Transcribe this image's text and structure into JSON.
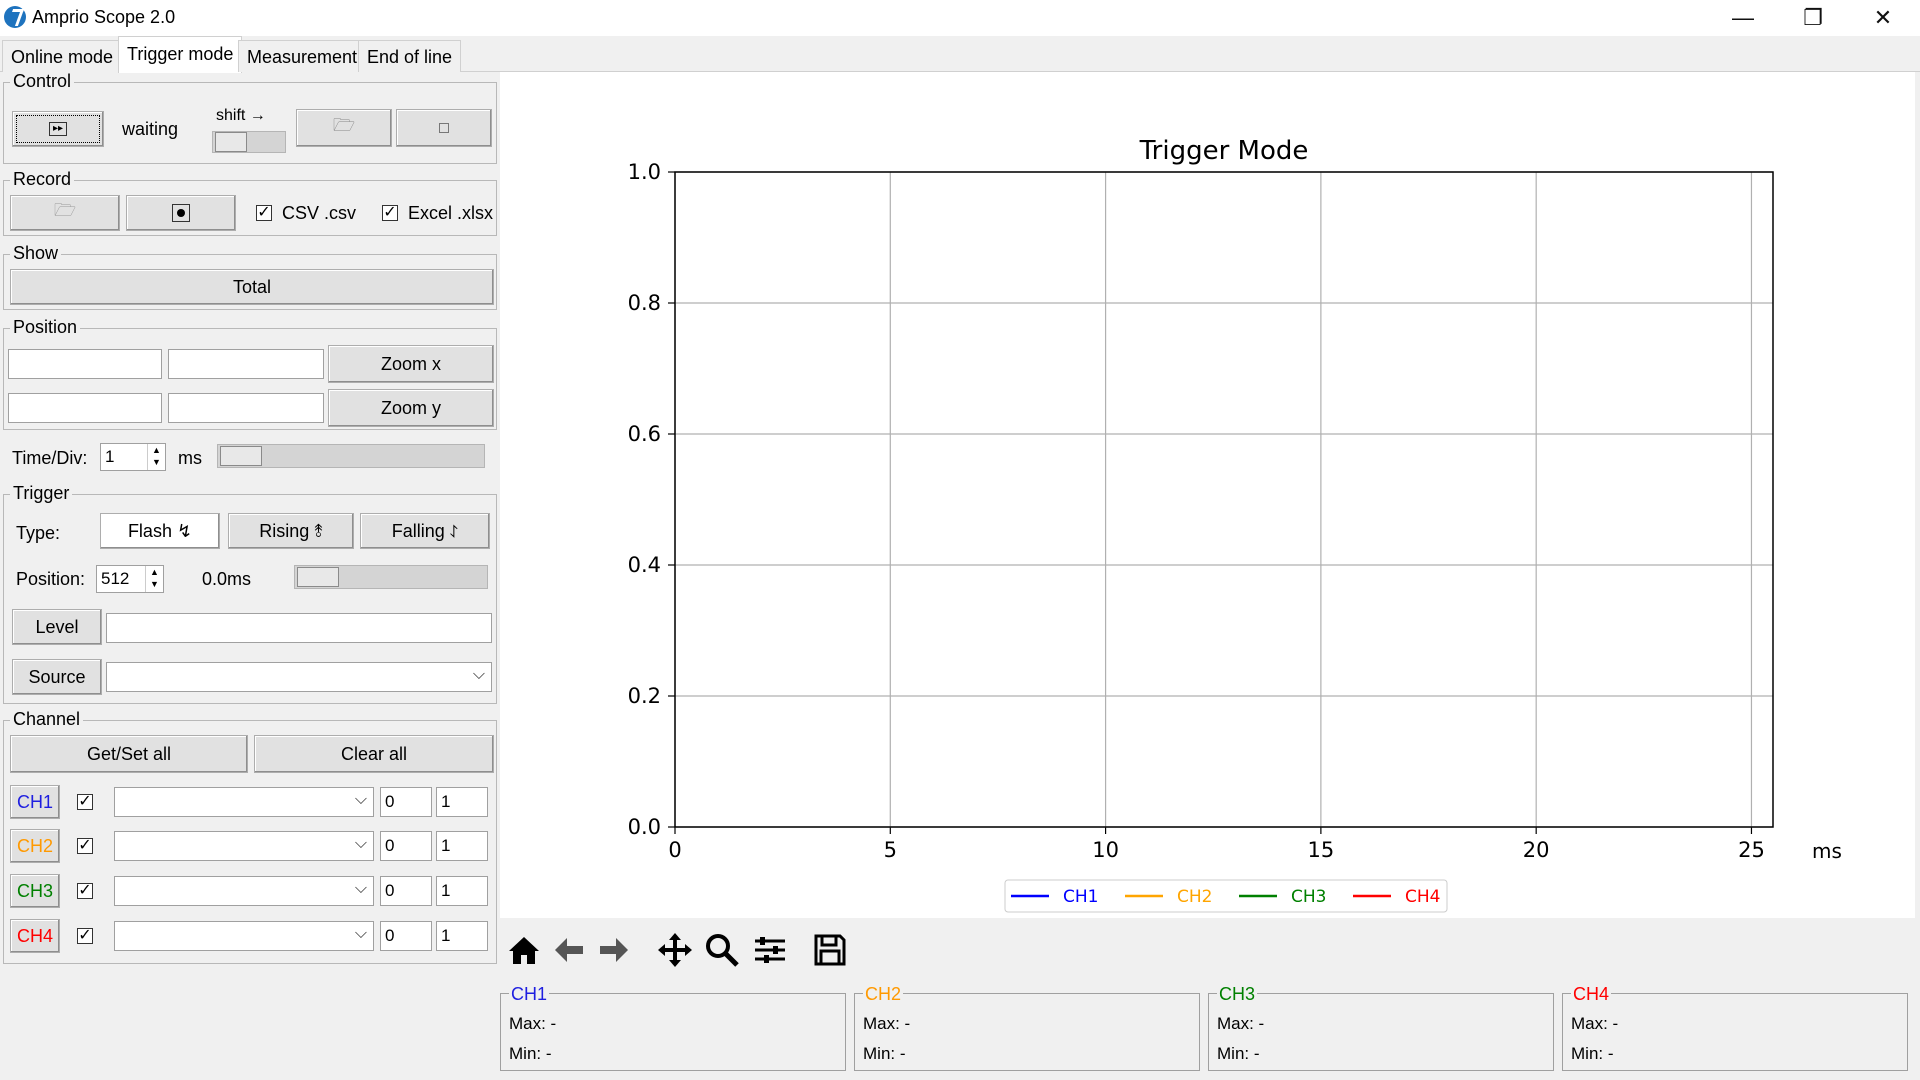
{
  "window": {
    "title": "Amprio Scope 2.0",
    "minimize": "—",
    "restore": "❐",
    "close": "✕"
  },
  "tabs": [
    "Online mode",
    "Trigger mode",
    "Measurement",
    "End of line"
  ],
  "control": {
    "title": "Control",
    "status": "waiting",
    "shift_label": "shift →"
  },
  "record": {
    "title": "Record",
    "csv_label": "CSV .csv",
    "excel_label": "Excel .xlsx",
    "csv_checked": true,
    "excel_checked": true
  },
  "show": {
    "title": "Show",
    "total_label": "Total"
  },
  "position": {
    "title": "Position",
    "zoom_x": "Zoom x",
    "zoom_y": "Zoom y"
  },
  "timediv": {
    "label": "Time/Div:",
    "value": "1",
    "unit": "ms"
  },
  "trigger": {
    "title": "Trigger",
    "type_label": "Type:",
    "flash": "Flash ↯",
    "rising": "Rising ⥉",
    "falling": "Falling ⥌",
    "position_label": "Position:",
    "position_value": "512",
    "time_value": "0.0ms",
    "level_label": "Level",
    "source_label": "Source"
  },
  "channel": {
    "title": "Channel",
    "get_set_all": "Get/Set all",
    "clear_all": "Clear all",
    "rows": [
      {
        "name": "CH1",
        "color": "#1f1fe0",
        "min": "0",
        "max": "1"
      },
      {
        "name": "CH2",
        "color": "#ff9900",
        "min": "0",
        "max": "1"
      },
      {
        "name": "CH3",
        "color": "#008000",
        "min": "0",
        "max": "1"
      },
      {
        "name": "CH4",
        "color": "#ff0000",
        "min": "0",
        "max": "1"
      }
    ]
  },
  "chart_data": {
    "type": "line",
    "title": "Trigger Mode",
    "xlabel": "ms",
    "ylabel": "",
    "xlim": [
      0,
      25.5
    ],
    "ylim": [
      0,
      1.0
    ],
    "x_ticks": [
      "0",
      "5",
      "10",
      "15",
      "20",
      "25"
    ],
    "y_ticks": [
      "0.0",
      "0.2",
      "0.4",
      "0.6",
      "0.8",
      "1.0"
    ],
    "grid": true,
    "legend_position": "bottom-center",
    "series": [
      {
        "name": "CH1",
        "color": "#0000ff",
        "values": []
      },
      {
        "name": "CH2",
        "color": "#ffa500",
        "values": []
      },
      {
        "name": "CH3",
        "color": "#008000",
        "values": []
      },
      {
        "name": "CH4",
        "color": "#ff0000",
        "values": []
      }
    ]
  },
  "toolbar": [
    "home-icon",
    "back-arrow-icon",
    "forward-arrow-icon",
    "pan-icon",
    "zoom-icon",
    "configure-icon",
    "save-icon"
  ],
  "stats": [
    {
      "name": "CH1",
      "color": "#1f1fe0",
      "max": "Max: -",
      "min": "Min: -"
    },
    {
      "name": "CH2",
      "color": "#ff9900",
      "max": "Max: -",
      "min": "Min: -"
    },
    {
      "name": "CH3",
      "color": "#008000",
      "max": "Max: -",
      "min": "Min: -"
    },
    {
      "name": "CH4",
      "color": "#ff0000",
      "max": "Max: -",
      "min": "Min: -"
    }
  ]
}
